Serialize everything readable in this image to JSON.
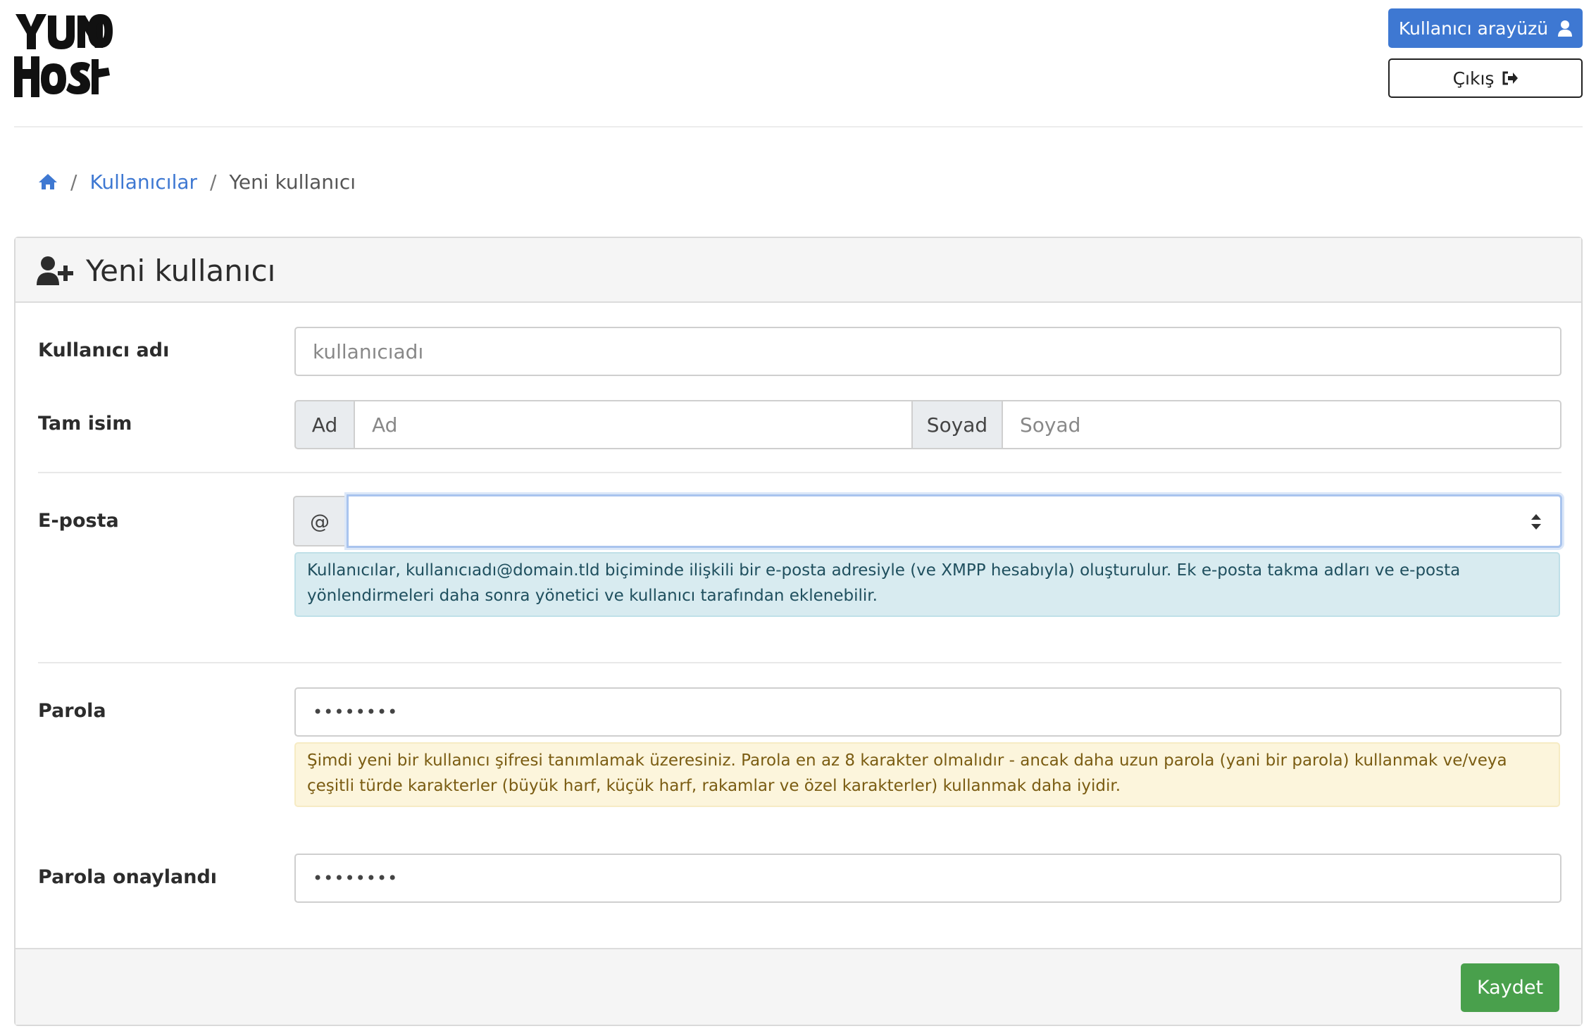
{
  "header": {
    "logo_text": "YUNOHOST",
    "user_interface_button": "Kullanıcı arayüzü",
    "logout_button": "Çıkış"
  },
  "breadcrumb": {
    "separator": "/",
    "users": "Kullanıcılar",
    "current": "Yeni kullanıcı"
  },
  "form": {
    "title": "Yeni kullanıcı",
    "username": {
      "label": "Kullanıcı adı",
      "placeholder": "kullanıcıadı",
      "value": ""
    },
    "fullname": {
      "label": "Tam isim",
      "first_addon": "Ad",
      "first_placeholder": "Ad",
      "last_addon": "Soyad",
      "last_placeholder": "Soyad"
    },
    "email": {
      "label": "E-posta",
      "addon": "@",
      "selected_domain": "",
      "help": "Kullanıcılar, kullanıcıadı@domain.tld biçiminde ilişkili bir e-posta adresiyle (ve XMPP hesabıyla) oluşturulur. Ek e-posta takma adları ve e-posta yönlendirmeleri daha sonra yönetici ve kullanıcı tarafından eklenebilir."
    },
    "password": {
      "label": "Parola",
      "placeholder": "••••••••",
      "help": "Şimdi yeni bir kullanıcı şifresi tanımlamak üzeresiniz. Parola en az 8 karakter olmalıdır - ancak daha uzun parola (yani bir parola) kullanmak ve/veya çeşitli türde karakterler (büyük harf, küçük harf, rakamlar ve özel karakterler) kullanmak daha iyidir."
    },
    "password_confirm": {
      "label": "Parola onaylandı",
      "placeholder": "••••••••"
    },
    "save_button": "Kaydet"
  },
  "colors": {
    "primary": "#3e78d2",
    "success": "#49a04c",
    "info_bg": "#d8ebf0",
    "warning_bg": "#fcf5dc"
  },
  "icons": {
    "user_interface": "user-icon",
    "logout": "sign-out-icon",
    "home": "home-icon",
    "title": "user-plus-icon",
    "select": "sort-icon"
  }
}
